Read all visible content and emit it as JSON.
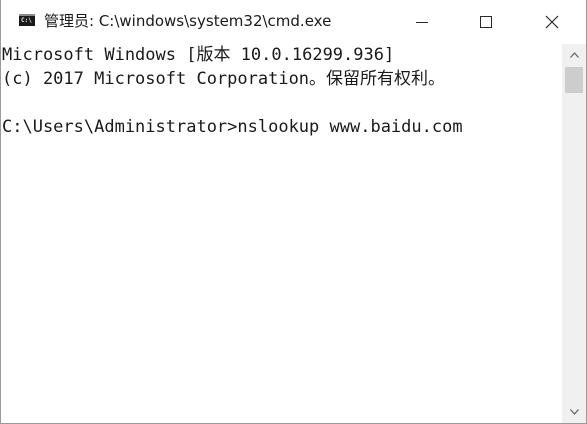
{
  "window": {
    "title": "管理员: C:\\windows\\system32\\cmd.exe",
    "icon": "cmd-icon",
    "icon_glyph": "C:\\"
  },
  "caption_buttons": {
    "minimize_icon": "minimize-icon",
    "maximize_icon": "maximize-icon",
    "close_icon": "close-icon"
  },
  "console": {
    "lines": [
      "Microsoft Windows [版本 10.0.16299.936]",
      "(c) 2017 Microsoft Corporation。保留所有权利。",
      "",
      "C:\\Users\\Administrator>nslookup www.baidu.com"
    ]
  },
  "scrollbar": {
    "up_icon": "scroll-up-arrow-icon",
    "down_icon": "scroll-down-arrow-icon"
  },
  "colors": {
    "console_background": "#ffffff",
    "console_text": "#1a1a1a",
    "titlebar_background": "#ffffff",
    "scrollbar_track": "#f0f0f0",
    "scrollbar_thumb": "#cdcdcd"
  }
}
